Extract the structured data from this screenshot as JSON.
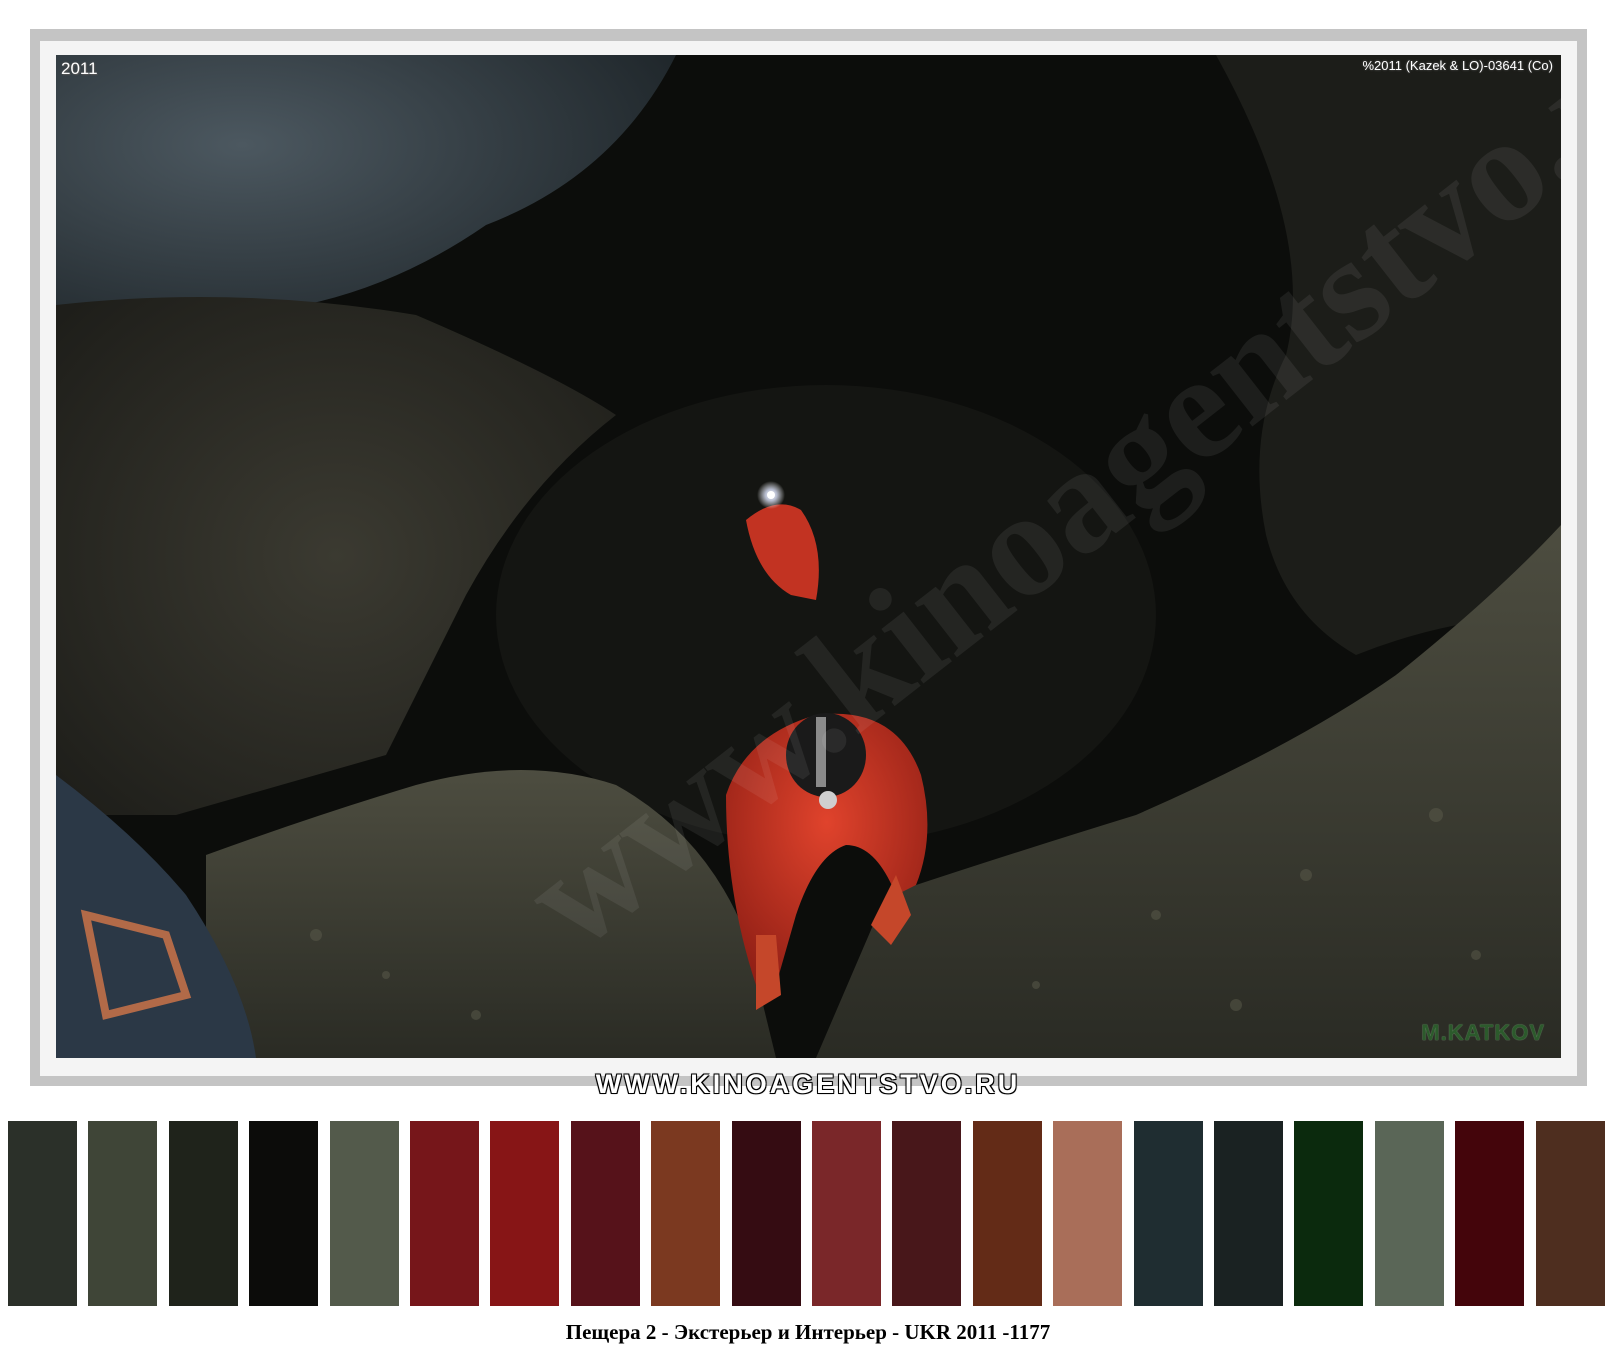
{
  "photo": {
    "year_stamp": "2011",
    "copyright_stamp": "%2011 (Kazek & LO)-03641 (Co)",
    "photographer_stamp": "M.KATKOV",
    "watermark_text": "www.kinoagentstvo.ru"
  },
  "site_banner": "WWW.KINOAGENTSTVO.RU",
  "palette": [
    {
      "color": "#2b3029"
    },
    {
      "color": "#3f4537"
    },
    {
      "color": "#1f231b"
    },
    {
      "color": "#0c0c0a"
    },
    {
      "color": "#535a4b"
    },
    {
      "color": "#76161a"
    },
    {
      "color": "#871516"
    },
    {
      "color": "#56121a"
    },
    {
      "color": "#7b3920"
    },
    {
      "color": "#350c12"
    },
    {
      "color": "#7a2729"
    },
    {
      "color": "#48171a"
    },
    {
      "color": "#632b17"
    },
    {
      "color": "#a96e59"
    },
    {
      "color": "#1f2d31"
    },
    {
      "color": "#1a2222"
    },
    {
      "color": "#0b2a0d"
    },
    {
      "color": "#5a6657"
    },
    {
      "color": "#44050b"
    },
    {
      "color": "#4e2e1f"
    }
  ],
  "caption": "Пещера 2 - Экстерьер и Интерьер - UKR 2011 -1177"
}
